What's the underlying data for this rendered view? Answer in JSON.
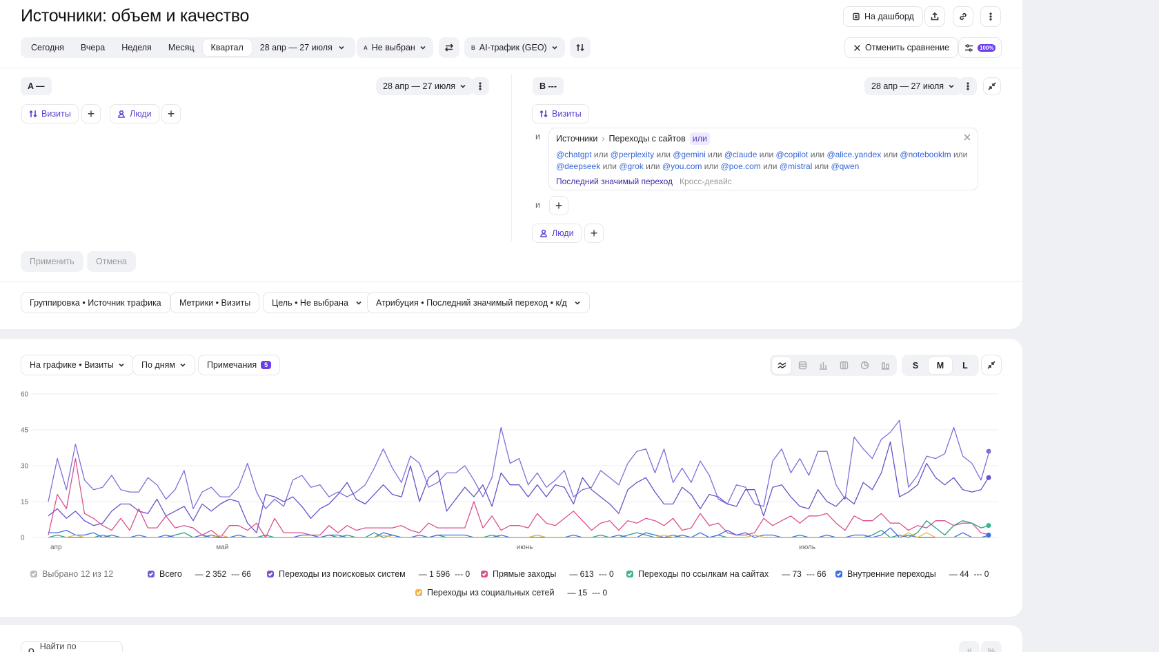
{
  "page": {
    "title": "Источники: объем и качество"
  },
  "header_actions": {
    "dashboard_label": "На дашборд"
  },
  "periods": [
    {
      "label": "Сегодня",
      "active": false
    },
    {
      "label": "Вчера",
      "active": false
    },
    {
      "label": "Неделя",
      "active": false
    },
    {
      "label": "Месяц",
      "active": false
    },
    {
      "label": "Квартал",
      "active": true
    }
  ],
  "period_range": "28 апр — 27 июля",
  "segment_a_select": {
    "tag": "A",
    "label": "Не выбран"
  },
  "segment_b_select": {
    "tag": "B",
    "label": "AI-трафик (GEO)"
  },
  "compare": {
    "cancel_label": "Отменить сравнение",
    "sample_badge": "100%"
  },
  "segment_a": {
    "label": "A —",
    "date": "28 апр — 27 июля",
    "visits_label": "Визиты",
    "people_label": "Люди"
  },
  "segment_b": {
    "label": "B ---",
    "date": "28 апр — 27 июля",
    "visits_label": "Визиты",
    "people_label": "Люди",
    "and_label": "и",
    "filter": {
      "path_1": "Источники",
      "path_sep": "›",
      "path_2": "Переходы с сайтов",
      "operator": "или",
      "tokens": [
        "@chatgpt",
        "@perplexity",
        "@gemini",
        "@claude",
        "@copilot",
        "@alice.yandex",
        "@notebooklm",
        "@deepseek",
        "@grok",
        "@you.com",
        "@poe.com",
        "@mistral",
        "@qwen"
      ],
      "joiner": "или",
      "attribution": "Последний значимый переход",
      "cross_device": "Кросс-девайс"
    }
  },
  "actions": {
    "apply_label": "Применить",
    "cancel_label": "Отмена"
  },
  "settings": [
    "Группировка • Источник трафика",
    "Метрики • Визиты",
    "Цель • Не выбрана",
    "Атрибуция • Последний значимый переход • к/д"
  ],
  "chart_toolbar": {
    "metric_label": "На графике • Визиты",
    "granularity_label": "По дням",
    "notes_label": "Примечания",
    "notes_count": "5",
    "sizes": [
      "S",
      "M",
      "L"
    ],
    "active_size": "M"
  },
  "legend": {
    "selected_label": "Выбрано 12 из 12",
    "items": [
      {
        "label": "Всего",
        "a": "— 2 352",
        "b": "--- 66",
        "color": "#6a5fd6"
      },
      {
        "label": "Переходы из поисковых систем",
        "a": "— 1 596",
        "b": "--- 0",
        "color": "#7b4fd0"
      },
      {
        "label": "Прямые заходы",
        "a": "— 613",
        "b": "--- 0",
        "color": "#d94f8f"
      },
      {
        "label": "Переходы по ссылкам на сайтах",
        "a": "— 73",
        "b": "--- 66",
        "color": "#3bb58a"
      },
      {
        "label": "Внутренние переходы",
        "a": "— 44",
        "b": "--- 0",
        "color": "#3c6fe0"
      },
      {
        "label": "Переходы из социальных сетей",
        "a": "— 15",
        "b": "--- 0",
        "color": "#f2b54a"
      }
    ]
  },
  "search": {
    "placeholder": "Найти по названию"
  },
  "chart_data": {
    "type": "line",
    "ylim": [
      0,
      60
    ],
    "yticks": [
      0,
      15,
      30,
      45,
      60
    ],
    "x_labels": [
      "апр",
      "май",
      "июнь",
      "июль"
    ],
    "series": [
      {
        "name": "Всего",
        "color": "#7c6fd9",
        "values": [
          15,
          33,
          20,
          39,
          24,
          20,
          21,
          26,
          20,
          19,
          19,
          25,
          22,
          16,
          20,
          28,
          12,
          19,
          21,
          17,
          17,
          21,
          31,
          19,
          12,
          16,
          13,
          24,
          26,
          21,
          22,
          17,
          19,
          17,
          19,
          22,
          29,
          37,
          29,
          23,
          34,
          31,
          21,
          23,
          27,
          27,
          30,
          24,
          17,
          25,
          46,
          31,
          33,
          22,
          27,
          21,
          24,
          28,
          17,
          20,
          21,
          28,
          25,
          22,
          31,
          36,
          37,
          27,
          37,
          23,
          29,
          23,
          32,
          26,
          16,
          14,
          22,
          21,
          14,
          13,
          32,
          37,
          27,
          33,
          26,
          36,
          36,
          22,
          16,
          42,
          37,
          33,
          41,
          44,
          49,
          21,
          26,
          34,
          33,
          35,
          46,
          34,
          31,
          24,
          37
        ]
      },
      {
        "name": "Переходы из поисковых систем",
        "color": "#6a4fc8",
        "values": [
          9,
          12,
          8,
          11,
          7,
          5,
          6,
          11,
          14,
          14,
          11,
          10,
          16,
          9,
          11,
          13,
          7,
          14,
          11,
          14,
          16,
          15,
          6,
          2,
          18,
          17,
          15,
          17,
          13,
          8,
          12,
          14,
          18,
          23,
          16,
          14,
          18,
          22,
          18,
          17,
          30,
          15,
          25,
          28,
          11,
          16,
          21,
          17,
          22,
          13,
          27,
          22,
          22,
          17,
          22,
          17,
          22,
          21,
          14,
          25,
          20,
          17,
          14,
          10,
          20,
          23,
          25,
          19,
          14,
          14,
          21,
          18,
          12,
          18,
          17,
          14,
          13,
          20,
          20,
          9,
          21,
          22,
          17,
          13,
          12,
          20,
          15,
          13,
          17,
          14,
          23,
          20,
          27,
          40,
          17,
          19,
          22,
          31,
          25,
          22,
          25,
          20,
          19,
          20,
          26
        ]
      },
      {
        "name": "Прямые заходы",
        "color": "#d94f8f",
        "values": [
          1,
          18,
          12,
          33,
          10,
          8,
          5,
          3,
          8,
          3,
          12,
          4,
          4,
          9,
          4,
          5,
          4,
          1,
          3,
          0,
          5,
          5,
          3,
          6,
          0,
          8,
          2,
          2,
          2,
          1,
          1,
          5,
          2,
          5,
          3,
          4,
          4,
          4,
          4,
          5,
          3,
          2,
          6,
          4,
          4,
          4,
          4,
          15,
          4,
          9,
          3,
          5,
          5,
          4,
          10,
          6,
          5,
          8,
          11,
          7,
          3,
          6,
          7,
          3,
          7,
          6,
          8,
          7,
          5,
          8,
          3,
          4,
          10,
          5,
          6,
          2,
          1,
          1,
          2,
          8,
          5,
          7,
          9,
          6,
          9,
          9,
          10,
          6,
          3,
          9,
          7,
          7,
          10,
          6,
          6,
          3,
          5,
          4,
          7,
          7,
          5,
          6,
          6,
          2,
          1
        ]
      },
      {
        "name": "Переходы по ссылкам на сайтах",
        "color": "#2a9d8f",
        "values": [
          0,
          1,
          0,
          0,
          0,
          0,
          1,
          0,
          0,
          0,
          0,
          0,
          0,
          0,
          1,
          2,
          0,
          0,
          1,
          0,
          0,
          0,
          0,
          0,
          1,
          0,
          0,
          0,
          0,
          0,
          0,
          1,
          0,
          1,
          0,
          0,
          2,
          0,
          1,
          0,
          0,
          0,
          0,
          1,
          0,
          0,
          0,
          0,
          0,
          1,
          0,
          0,
          0,
          0,
          0,
          0,
          0,
          0,
          0,
          0,
          0,
          1,
          0,
          0,
          1,
          2,
          1,
          0,
          0,
          1,
          0,
          0,
          0,
          0,
          1,
          0,
          0,
          0,
          1,
          0,
          0,
          0,
          0,
          0,
          0,
          0,
          0,
          0,
          0,
          0,
          0,
          1,
          3,
          0,
          1,
          0,
          2,
          7,
          4,
          1,
          5,
          7,
          6,
          4,
          5
        ]
      },
      {
        "name": "Внутренние переходы",
        "color": "#3c6fe0",
        "values": [
          2,
          2,
          3,
          1,
          1,
          2,
          0,
          1,
          0,
          0,
          1,
          0,
          0,
          1,
          0,
          0,
          0,
          1,
          0,
          0,
          0,
          1,
          0,
          0,
          0,
          0,
          0,
          0,
          1,
          1,
          0,
          1,
          1,
          0,
          0,
          0,
          0,
          2,
          1,
          0,
          0,
          1,
          0,
          1,
          1,
          1,
          1,
          0,
          0,
          0,
          1,
          0,
          0,
          0,
          1,
          0,
          0,
          0,
          1,
          0,
          0,
          0,
          0,
          1,
          0,
          0,
          2,
          1,
          0,
          0,
          1,
          0,
          2,
          0,
          1,
          3,
          1,
          2,
          0,
          1,
          1,
          0,
          0,
          1,
          0,
          0,
          1,
          0,
          0,
          1,
          1,
          0,
          1,
          4,
          0,
          1,
          0,
          0,
          0,
          0,
          0,
          2,
          0,
          0,
          1
        ]
      },
      {
        "name": "Переходы из социальных сетей",
        "color": "#f2b54a",
        "values": [
          0,
          0,
          0,
          1,
          0,
          0,
          0,
          0,
          0,
          0,
          0,
          0,
          0,
          0,
          0,
          0,
          0,
          0,
          0,
          1,
          0,
          0,
          0,
          0,
          0,
          0,
          0,
          0,
          0,
          0,
          0,
          0,
          0,
          0,
          0,
          0,
          0,
          1,
          0,
          0,
          0,
          0,
          0,
          0,
          0,
          0,
          0,
          0,
          0,
          0,
          0,
          0,
          0,
          0,
          1,
          0,
          0,
          0,
          0,
          0,
          0,
          0,
          0,
          0,
          0,
          0,
          0,
          0,
          1,
          0,
          0,
          0,
          0,
          0,
          0,
          0,
          0,
          0,
          1,
          0,
          0,
          0,
          0,
          0,
          0,
          0,
          0,
          0,
          0,
          0,
          0,
          0,
          0,
          0,
          0,
          2,
          0,
          2,
          0,
          0,
          0,
          0,
          0,
          0,
          0
        ]
      }
    ],
    "end_points": [
      {
        "series": "Всего",
        "value": 36,
        "color": "#7c6fd9"
      },
      {
        "series": "Переходы из поисковых систем",
        "value": 25,
        "color": "#6a4fc8"
      },
      {
        "series": "Переходы по ссылкам на сайтах",
        "value": 5,
        "color": "#3bb58a"
      },
      {
        "series": "Внутренние переходы",
        "value": 1,
        "color": "#3c6fe0"
      }
    ]
  }
}
